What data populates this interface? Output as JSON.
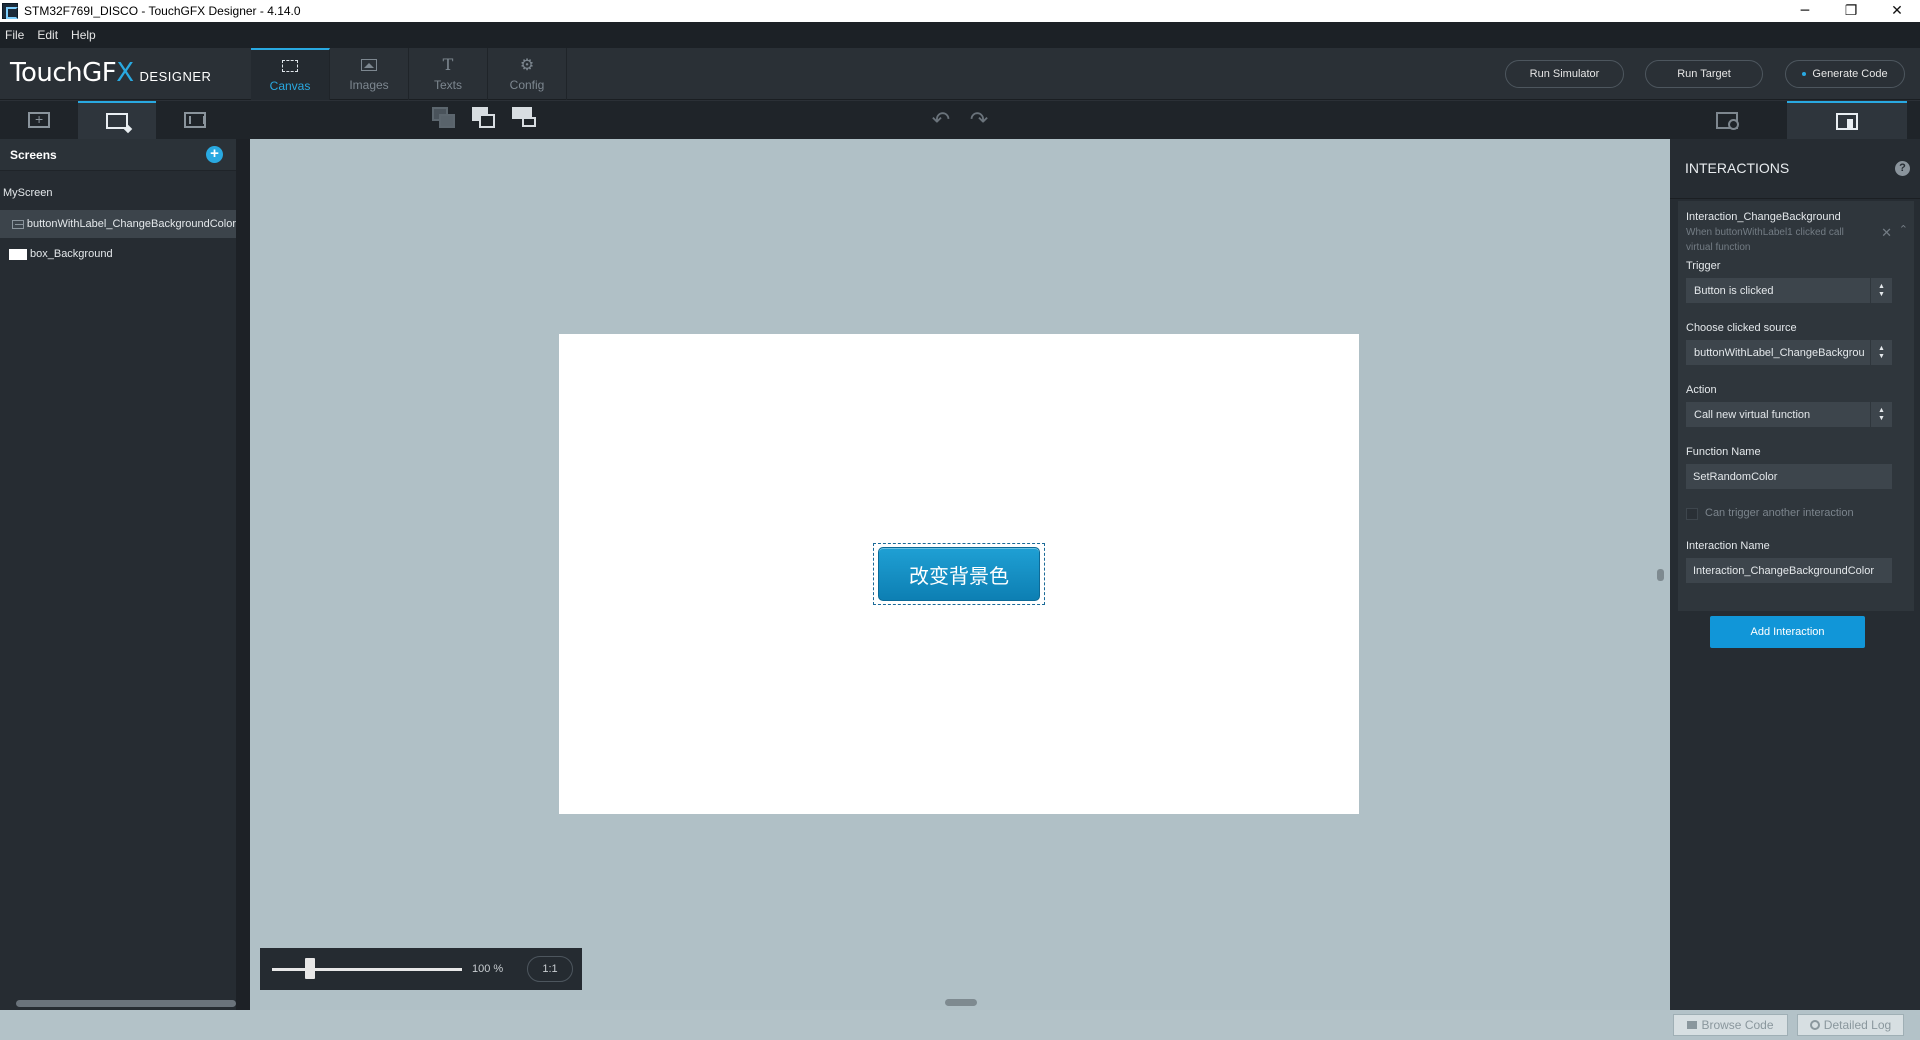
{
  "window": {
    "title": "STM32F769I_DISCO - TouchGFX Designer - 4.14.0",
    "minimize_glyph": "─",
    "restore_glyph": "❐",
    "close_glyph": "✕"
  },
  "menubar": {
    "items": [
      "File",
      "Edit",
      "Help"
    ]
  },
  "header": {
    "logo_brand_main": "TouchGF",
    "logo_brand_x": "X",
    "logo_designer": "DESIGNER",
    "tabs": [
      {
        "label": "Canvas",
        "icon": "canvas-icon"
      },
      {
        "label": "Images",
        "icon": "images-icon"
      },
      {
        "label": "Texts",
        "icon": "texts-icon",
        "glyph": "T"
      },
      {
        "label": "Config",
        "icon": "config-icon",
        "glyph": "⚙"
      }
    ],
    "active_tab": "Canvas",
    "run_simulator": "Run Simulator",
    "run_target": "Run Target",
    "generate_code": "Generate Code"
  },
  "toolbar": {
    "undo_glyph": "↶",
    "redo_glyph": "↷"
  },
  "left_panel": {
    "title": "Screens",
    "add_glyph": "+",
    "tree": [
      {
        "label": "MyScreen",
        "type": "screen"
      },
      {
        "label": "buttonWithLabel_ChangeBackgroundColor",
        "type": "button",
        "selected": true
      },
      {
        "label": "box_Background",
        "type": "box"
      }
    ]
  },
  "canvas": {
    "button_label": "改变背景色",
    "zoom_value": "100 %",
    "zoom_fraction": 0.2,
    "zoom_reset": "1:1"
  },
  "right_panel": {
    "title": "INTERACTIONS",
    "help_glyph": "?",
    "interaction": {
      "name": "Interaction_ChangeBackground",
      "description": "When buttonWithLabel1 clicked call virtual function",
      "close_glyph": "✕",
      "collapse_glyph": "⌃",
      "trigger_label": "Trigger",
      "trigger_value": "Button is clicked",
      "source_label": "Choose clicked source",
      "source_value": "buttonWithLabel_ChangeBackgrou",
      "action_label": "Action",
      "action_value": "Call new virtual function",
      "function_label": "Function Name",
      "function_value": "SetRandomColor",
      "can_trigger_label": "Can trigger another interaction",
      "can_trigger_checked": false,
      "ia_name_label": "Interaction Name",
      "ia_name_value": "Interaction_ChangeBackgroundColor"
    },
    "add_button": "Add Interaction"
  },
  "statusbar": {
    "browse_code": "Browse Code",
    "detailed_log": "Detailed Log"
  },
  "colors": {
    "accent": "#29a9e1",
    "canvas_bg": "#b0c0c6",
    "widget_button": "#1690c8",
    "add_interaction": "#1196d8"
  }
}
